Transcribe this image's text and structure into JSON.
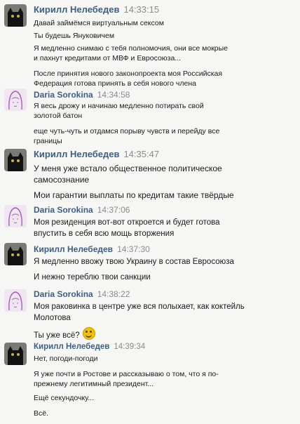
{
  "messages": [
    {
      "author": "Кирилл Нелебедев",
      "time": "14:33:15",
      "avatar": "black-cat-avatar",
      "lines": [
        "Давай займёмся виртуальным сексом",
        "Ты будешь Януковичем",
        "Я медленно снимаю с тебя полномочия, они все мокрые",
        "и пахнут кредитами от МВФ и Евросоюза...",
        "После принятия нового законопроекта моя Российская",
        "Федерация готова принять в себя нового члена"
      ]
    },
    {
      "author": "Daria Sorokina",
      "time": "14:34:58",
      "avatar": "girl-sketch-avatar",
      "lines": [
        "Я весь дрожу и начинаю медленно потирать свой",
        "золотой батон",
        "еще чуть-чуть и отдамся порыву чувств и перейду все",
        "границы"
      ]
    },
    {
      "author": "Кирилл Нелебедев",
      "time": "14:35:47",
      "avatar": "black-cat-avatar",
      "lines": [
        "У меня уже встало общественное политическое",
        "самосознание",
        "Мои гарантии выплаты по кредитам такие твёрдые"
      ]
    },
    {
      "author": "Daria Sorokina",
      "time": "14:37:06",
      "avatar": "girl-sketch-avatar",
      "lines": [
        "Моя резиденция вот-вот откроется и будет готова",
        "впустить в себя всю мощь вторжения"
      ]
    },
    {
      "author": "Кирилл Нелебедев",
      "time": "14:37:30",
      "avatar": "black-cat-avatar",
      "lines": [
        "Я медленно ввожу твою Украину в состав Евросоюза",
        "И нежно тереблю твои санкции"
      ]
    },
    {
      "author": "Daria Sorokina",
      "time": "14:38:22",
      "avatar": "girl-sketch-avatar",
      "lines": [
        "Моя раковинка в центре уже вся полыхает, как коктейль",
        "Молотова",
        "Ты уже всё?"
      ]
    },
    {
      "author": "Кирилл Нелебедев",
      "time": "14:39:34",
      "avatar": "black-cat-avatar",
      "lines": [
        "Нет, погоди-погоди",
        "Я уже почти в Ростове и рассказываю о том, что я по-",
        "прежнему легитимный президент...",
        "Ещё секундочку...",
        "Всё."
      ]
    }
  ],
  "emoji": "smile-emoji-icon"
}
